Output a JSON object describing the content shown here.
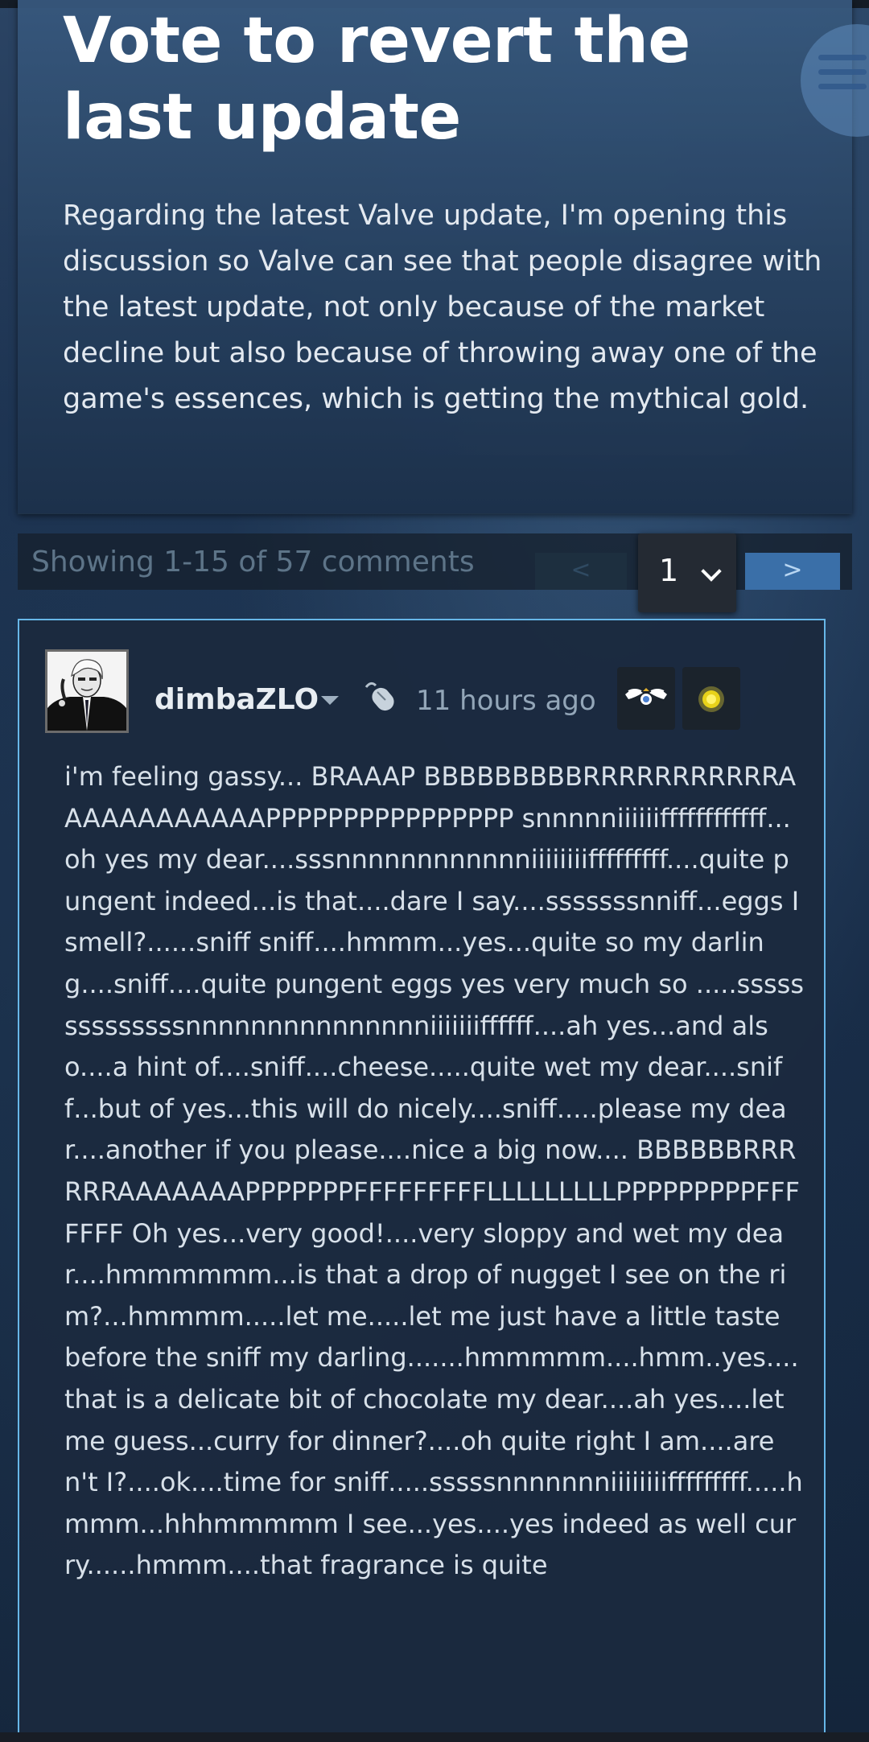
{
  "topic": {
    "title": "Vote to revert the last update",
    "body": "Regarding the latest Valve update, I'm opening this discussion so Valve can see that people disagree with the latest update, not only because of the market decline but also because of throwing away one of the game's essences, which is getting the mythical gold."
  },
  "pagination": {
    "showing_text": "Showing 1-15 of 57 comments",
    "prev_label": "<",
    "current_page": "1",
    "next_label": ">"
  },
  "comment": {
    "author": "dimbaZLO",
    "timestamp": "11 hours ago",
    "text": "i'm feeling gassy... BRAAAP BBBBBBBBBRRRRRRRRRRRAAAAAAAAAAAAPPPPPPPPPPPPPPPP snnnnniiiiiiffffffffffff...oh yes my dear....sssnnnnnnnnnnnniiiiiiiifffffffff....quite pungent indeed...is that....dare I say....sssssssnniff...eggs I smell?......sniff sniff....hmmm...yes...quite so my darling....sniff....quite pungent eggs yes very much so .....ssssssssssssssnnnnnnnnnnnnnnniiiiiiiffffff....ah yes...and also....a hint of....sniff....cheese.....quite wet my dear....sniff...but of yes...this will do nicely....sniff.....please my dear....another if you please....nice a big now.... BBBBBBRRRRRRAAAAAAAPPPPPPPFFFFFFFFFLLLLLLLLLPPPPPPPPPFFFFFFF Oh yes...very good!....very sloppy and wet my dear....hmmmmmm...is that a drop of nugget I see on the rim?...hmmmm.....let me.....let me just have a little taste before the sniff my darling.......hmmmmm....hmm..yes....that is a delicate bit of chocolate my dear....ah yes....let me guess...curry for dinner?....oh quite right I am....aren't I?....ok....time for sniff.....sssssnnnnnnniiiiiiiifffffffff.....hmmm...hhhmmmmm I see...yes....yes indeed as well curry......hmmm....that fragrance is quite"
  },
  "icons": {
    "menu": "hamburger-menu-icon",
    "dropdown": "chevron-down-icon",
    "mouse": "mouse-icon",
    "award_1": "wings-award-icon",
    "award_2": "gold-coin-award-icon"
  },
  "colors": {
    "accent": "#67b7e8",
    "next_button": "#3a6fa8",
    "card_background": "#1b2a3e",
    "award_gold": "#e8d21a"
  }
}
